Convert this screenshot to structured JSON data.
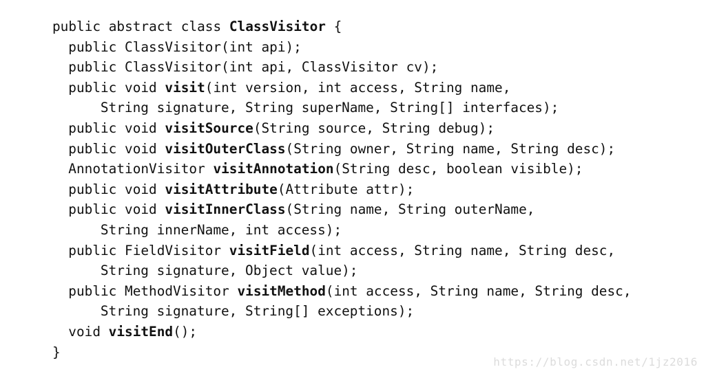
{
  "document": {
    "kind": "code-listing",
    "language": "java",
    "background_color": "#ffffff",
    "text_color": "#111111",
    "watermark_color": "#dcdcdc"
  },
  "code": {
    "lines": [
      {
        "indent": 0,
        "tokens": [
          {
            "text": "public abstract class ",
            "bold": false
          },
          {
            "text": "ClassVisitor",
            "bold": true
          },
          {
            "text": " {",
            "bold": false
          }
        ]
      },
      {
        "indent": 2,
        "tokens": [
          {
            "text": "public ClassVisitor(int api);",
            "bold": false
          }
        ]
      },
      {
        "indent": 2,
        "tokens": [
          {
            "text": "public ClassVisitor(int api, ClassVisitor cv);",
            "bold": false
          }
        ]
      },
      {
        "indent": 2,
        "tokens": [
          {
            "text": "public void ",
            "bold": false
          },
          {
            "text": "visit",
            "bold": true
          },
          {
            "text": "(int version, int access, String name,",
            "bold": false
          }
        ]
      },
      {
        "indent": 6,
        "tokens": [
          {
            "text": "String signature, String superName, String[] interfaces);",
            "bold": false
          }
        ]
      },
      {
        "indent": 2,
        "tokens": [
          {
            "text": "public void ",
            "bold": false
          },
          {
            "text": "visitSource",
            "bold": true
          },
          {
            "text": "(String source, String debug);",
            "bold": false
          }
        ]
      },
      {
        "indent": 2,
        "tokens": [
          {
            "text": "public void ",
            "bold": false
          },
          {
            "text": "visitOuterClass",
            "bold": true
          },
          {
            "text": "(String owner, String name, String desc);",
            "bold": false
          }
        ]
      },
      {
        "indent": 2,
        "tokens": [
          {
            "text": "AnnotationVisitor ",
            "bold": false
          },
          {
            "text": "visitAnnotation",
            "bold": true
          },
          {
            "text": "(String desc, boolean visible);",
            "bold": false
          }
        ]
      },
      {
        "indent": 2,
        "tokens": [
          {
            "text": "public void ",
            "bold": false
          },
          {
            "text": "visitAttribute",
            "bold": true
          },
          {
            "text": "(Attribute attr);",
            "bold": false
          }
        ]
      },
      {
        "indent": 2,
        "tokens": [
          {
            "text": "public void ",
            "bold": false
          },
          {
            "text": "visitInnerClass",
            "bold": true
          },
          {
            "text": "(String name, String outerName,",
            "bold": false
          }
        ]
      },
      {
        "indent": 6,
        "tokens": [
          {
            "text": "String innerName, int access);",
            "bold": false
          }
        ]
      },
      {
        "indent": 2,
        "tokens": [
          {
            "text": "public FieldVisitor ",
            "bold": false
          },
          {
            "text": "visitField",
            "bold": true
          },
          {
            "text": "(int access, String name, String desc,",
            "bold": false
          }
        ]
      },
      {
        "indent": 6,
        "tokens": [
          {
            "text": "String signature, Object value);",
            "bold": false
          }
        ]
      },
      {
        "indent": 2,
        "tokens": [
          {
            "text": "public MethodVisitor ",
            "bold": false
          },
          {
            "text": "visitMethod",
            "bold": true
          },
          {
            "text": "(int access, String name, String desc,",
            "bold": false
          }
        ]
      },
      {
        "indent": 6,
        "tokens": [
          {
            "text": "String signature, String[] exceptions);",
            "bold": false
          }
        ]
      },
      {
        "indent": 2,
        "tokens": [
          {
            "text": "void ",
            "bold": false
          },
          {
            "text": "visitEnd",
            "bold": true
          },
          {
            "text": "();",
            "bold": false
          }
        ]
      },
      {
        "indent": 0,
        "tokens": [
          {
            "text": "}",
            "bold": false
          }
        ]
      }
    ]
  },
  "watermark": {
    "text": "https://blog.csdn.net/1jz2016"
  }
}
